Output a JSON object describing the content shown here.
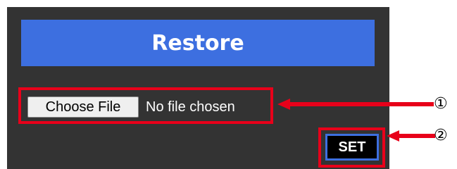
{
  "restore": {
    "title": "Restore",
    "choose_file_label": "Choose File",
    "file_status": "No file chosen",
    "set_label": "SET"
  },
  "annotations": [
    {
      "marker": "①"
    },
    {
      "marker": "②"
    }
  ],
  "colors": {
    "panel_bg": "#333333",
    "title_bar": "#3d6fe0",
    "highlight": "#e8001a",
    "set_border": "#3d6fe0"
  }
}
